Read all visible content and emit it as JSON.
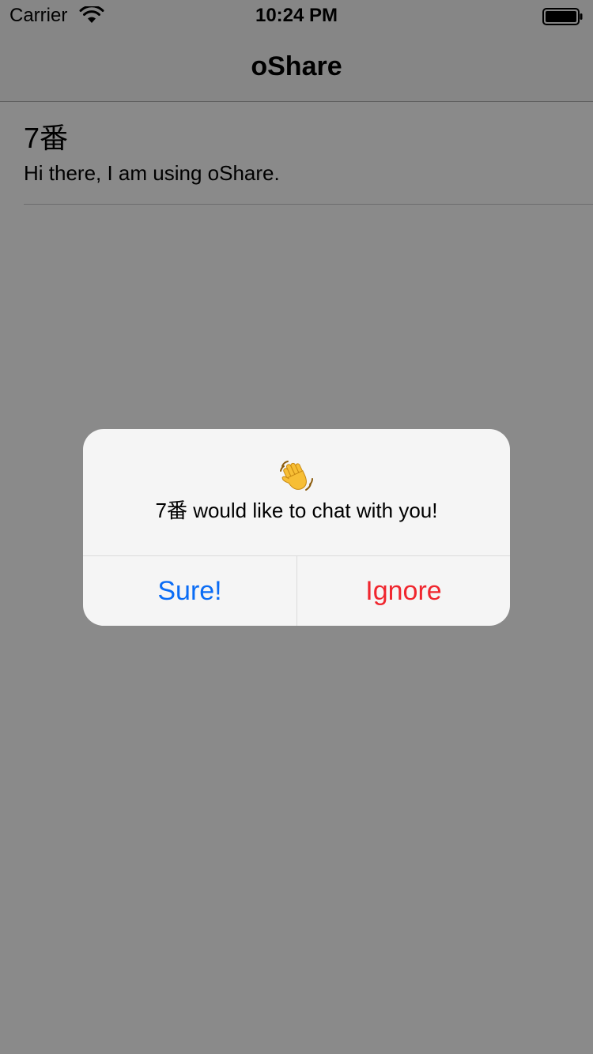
{
  "status_bar": {
    "carrier": "Carrier",
    "time": "10:24 PM",
    "wifi_icon": "wifi-icon",
    "battery_icon": "battery-icon"
  },
  "nav": {
    "title": "oShare"
  },
  "contacts": [
    {
      "name": "7番",
      "status": "Hi there, I am using oShare."
    }
  ],
  "alert": {
    "icon": "waving-hand-icon",
    "message": "7番 would like to chat with you!",
    "confirm_label": "Sure!",
    "cancel_label": "Ignore"
  },
  "colors": {
    "confirm": "#0a6cf5",
    "destructive": "#f0262e",
    "overlay": "#888888",
    "alert_background": "#f5f5f5"
  }
}
